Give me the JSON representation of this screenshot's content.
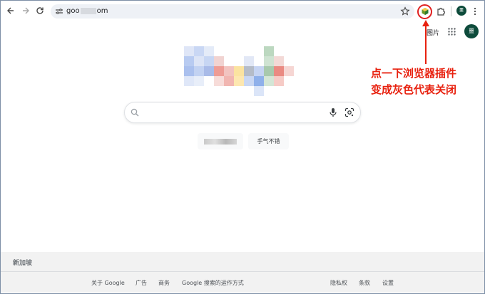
{
  "browser": {
    "url_prefix": "goo",
    "url_suffix": "om",
    "profile_initial": "噩"
  },
  "google": {
    "images_label": "图片",
    "avatar_initial": "噩",
    "search_placeholder": "",
    "lucky_label": "手气不错"
  },
  "annotation": {
    "line1": "点一下浏览器插件",
    "line2": "变成灰色代表关闭",
    "color": "#e8210f"
  },
  "footer": {
    "country": "新加坡",
    "links_left": [
      "关于 Google",
      "广告",
      "商务",
      "Google 搜索的运作方式"
    ],
    "links_right": [
      "隐私权",
      "条款",
      "设置"
    ]
  }
}
